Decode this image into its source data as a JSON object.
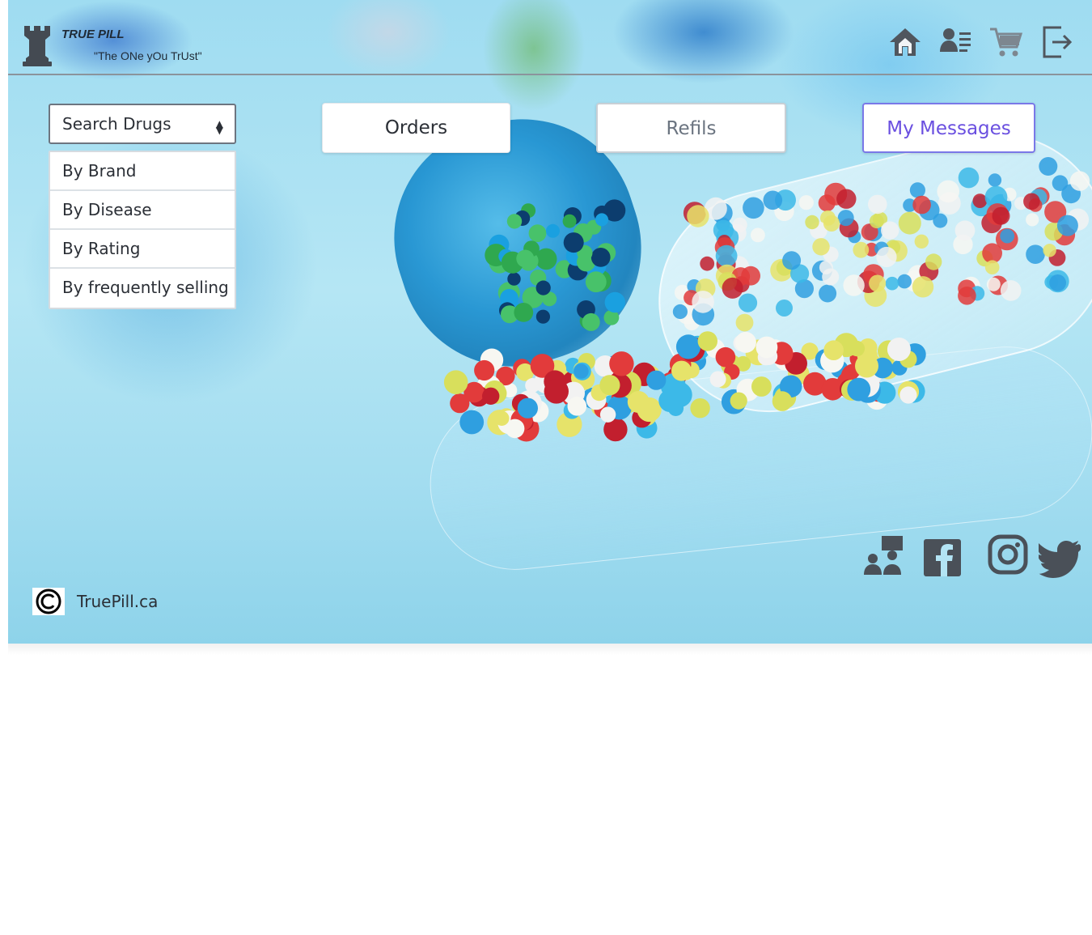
{
  "header": {
    "brand": "TRUE PILL",
    "tagline": "\"The ONe yOu TrUst\"",
    "nav_icons": [
      "home-icon",
      "user-profile-icon",
      "cart-icon",
      "logout-icon"
    ]
  },
  "search": {
    "selected": "Search Drugs",
    "options": [
      "By Brand",
      "By Disease",
      "By Rating",
      "By frequently selling"
    ]
  },
  "tabs": {
    "orders": "Orders",
    "refils": "Refils",
    "messages": "My Messages"
  },
  "social_icons": [
    "team-icon",
    "facebook-icon",
    "instagram-icon",
    "twitter-icon"
  ],
  "footer": {
    "copyright_icon": "copyright-icon",
    "site": "TruePill.ca"
  },
  "colors": {
    "accent": "#6a4fe0",
    "icon_gray": "#4a5058",
    "text": "#2b2f36"
  }
}
